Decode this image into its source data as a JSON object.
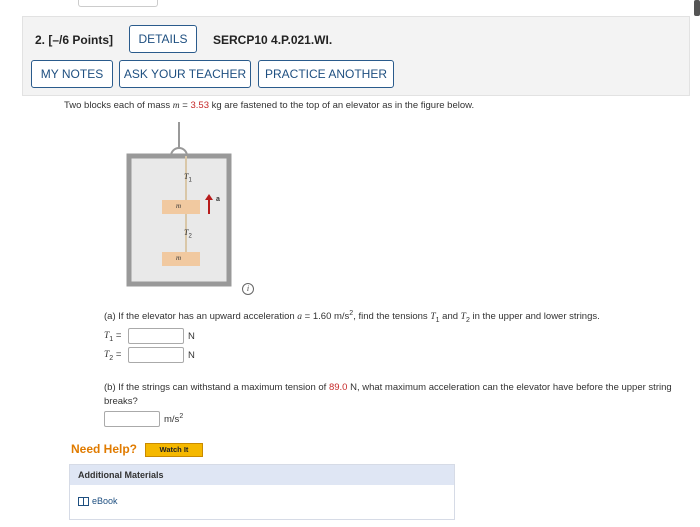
{
  "question": {
    "number_label": "2.",
    "points_label": "[–/6 Points]",
    "details_label": "DETAILS",
    "code_label": "SERCP10 4.P.021.WI."
  },
  "toolbar": {
    "my_notes_label": "MY NOTES",
    "ask_teacher_label": "ASK YOUR TEACHER",
    "practice_label": "PRACTICE ANOTHER"
  },
  "problem": {
    "intro_before": "Two blocks each of mass ",
    "mass_var": "m",
    "equals": " = ",
    "mass_value": "3.53",
    "intro_after": " kg are fastened to the top of an elevator as in the figure below."
  },
  "figure": {
    "t1_label": "T",
    "t1_sub": "1",
    "t2_label": "T",
    "t2_sub": "2",
    "mass_label": "m",
    "accel_label": "a"
  },
  "part_a": {
    "text_before": "(a) If the elevator has an upward acceleration ",
    "accel_var": "a",
    "accel_text": " = 1.60 m/s",
    "accel_exp": "2",
    "text_mid": ", find the tensions ",
    "t1_var": "T",
    "t1_sub": "1",
    "and": " and ",
    "t2_var": "T",
    "t2_sub": "2",
    "text_after": " in the upper and lower strings.",
    "answer1_label_var": "T",
    "answer1_label_sub": "1",
    "answer2_label_var": "T",
    "answer2_label_sub": "2",
    "equals": " =",
    "unit": "N"
  },
  "part_b": {
    "text_before": "(b) If the strings can withstand a maximum tension of ",
    "max_tension": "89.0",
    "text_after": " N, what maximum acceleration can the elevator have before the upper string breaks?",
    "unit_base": "m/s",
    "unit_exp": "2"
  },
  "help": {
    "need_help_label": "Need Help?",
    "watch_label": "Watch It"
  },
  "additional": {
    "header": "Additional Materials",
    "ebook_label": "eBook"
  },
  "colors": {
    "accent": "#2a5b8c",
    "highlight": "#c62828",
    "help_orange": "#e07b00",
    "watch_yellow": "#f5b800"
  },
  "icons": [
    "info-icon",
    "book-icon",
    "up-arrow-icon"
  ]
}
